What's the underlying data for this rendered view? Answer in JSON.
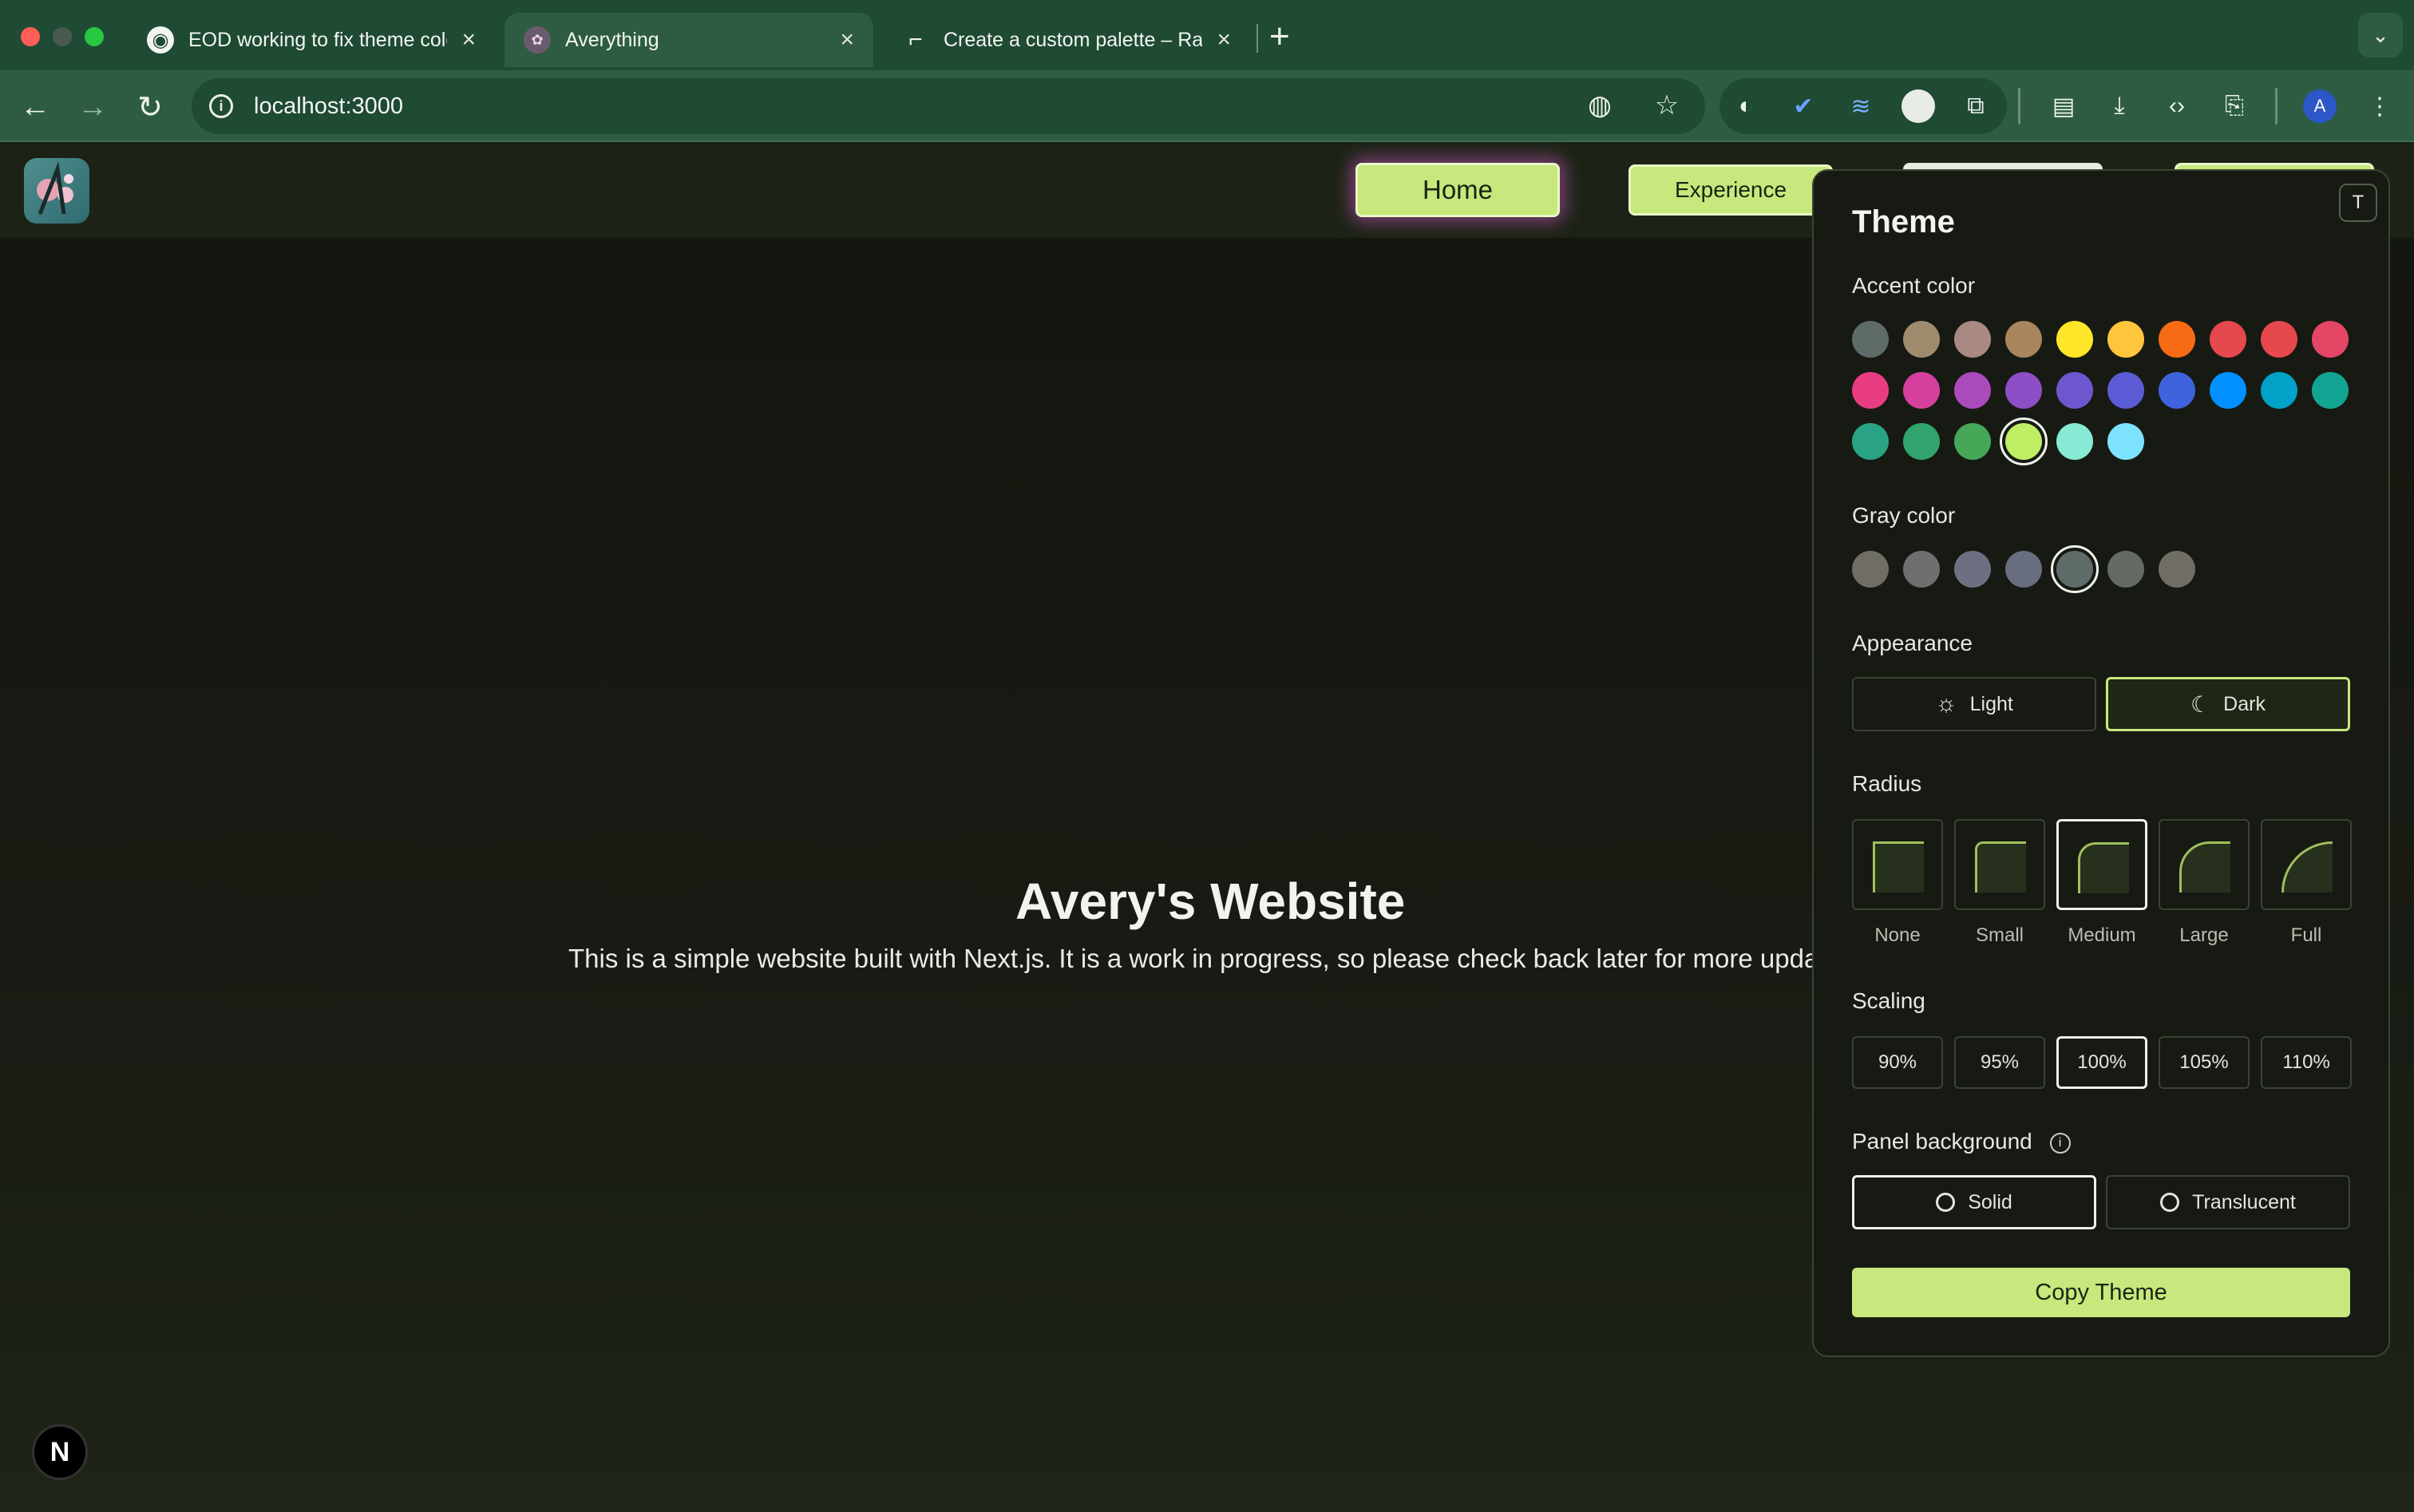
{
  "browser": {
    "tabs": [
      {
        "title": "EOD working to fix theme colo",
        "icon": "github-icon"
      },
      {
        "title": "Averything",
        "icon": "site-favicon-icon"
      },
      {
        "title": "Create a custom palette – Ra",
        "icon": "radix-icon"
      }
    ],
    "new_tab": "+",
    "url": "localhost:3000",
    "profile_initial": "A"
  },
  "site": {
    "nav": {
      "home": "Home",
      "experience": "Experience"
    },
    "hero_title": "Avery's Website",
    "hero_subtitle": "This is a simple website built with Next.js. It is a work in progress, so please check back later for more updat",
    "nextjs_badge": "N"
  },
  "theme_panel": {
    "toggle_label": "T",
    "title": "Theme",
    "accent_label": "Accent color",
    "accent_colors": [
      "#5f6b69",
      "#a08b6e",
      "#a98a82",
      "#a9855e",
      "#ffe629",
      "#ffc53d",
      "#f76b15",
      "#e5484d",
      "#e5484d",
      "#e54666",
      "#e93d82",
      "#d6409f",
      "#ab4aba",
      "#8e4ec6",
      "#6e56cf",
      "#5b5bd6",
      "#3e63dd",
      "#0090ff",
      "#00a2c7",
      "#12a594",
      "#29a383",
      "#30a46c",
      "#46a758",
      "#bdee63",
      "#86ead4",
      "#7ce2fe"
    ],
    "accent_selected_index": 23,
    "gray_label": "Gray color",
    "gray_colors": [
      "#6f6d66",
      "#6f6f6f",
      "#6e6f80",
      "#696e7e",
      "#5f6b69",
      "#646b65",
      "#6f6d64"
    ],
    "gray_selected_index": 4,
    "appearance_label": "Appearance",
    "appearance": {
      "light": "Light",
      "dark": "Dark",
      "selected": "Dark"
    },
    "radius_label": "Radius",
    "radius_options": [
      "None",
      "Small",
      "Medium",
      "Large",
      "Full"
    ],
    "radius_selected": "Medium",
    "scaling_label": "Scaling",
    "scaling_options": [
      "90%",
      "95%",
      "100%",
      "105%",
      "110%"
    ],
    "scaling_selected": "100%",
    "panel_bg_label": "Panel background",
    "panel_bg": {
      "solid": "Solid",
      "translucent": "Translucent",
      "selected": "Solid"
    },
    "copy_label": "Copy Theme",
    "accent_ui_color": "#c6e87c"
  }
}
